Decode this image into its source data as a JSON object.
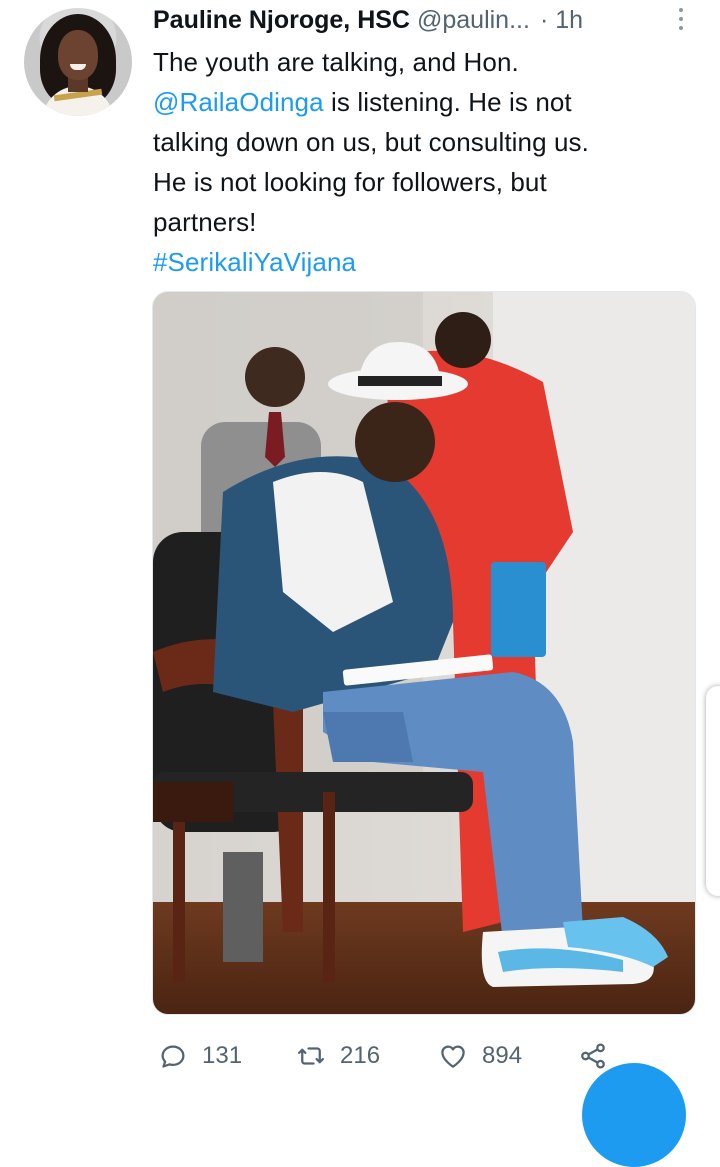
{
  "tweet": {
    "author_name": "Pauline Njoroge, HSC",
    "handle": "@paulin...",
    "time": "· 1h",
    "text_lines": [
      "The youth are talking, and Hon.",
      "is listening. He is not",
      "talking down on us, but consulting us.",
      "He is not looking for followers, but",
      "partners!"
    ],
    "mention": "@RailaOdinga",
    "hashtag": "#SerikaliYaVijana"
  },
  "actions": {
    "replies": "131",
    "retweets": "216",
    "likes": "894"
  },
  "icons": {
    "more": "more-vertical-icon",
    "reply": "reply-icon",
    "retweet": "retweet-icon",
    "like": "heart-icon",
    "share": "share-icon"
  },
  "colors": {
    "link": "#1d9bf0",
    "secondary_text": "#536471",
    "primary_text": "#0f1419"
  }
}
